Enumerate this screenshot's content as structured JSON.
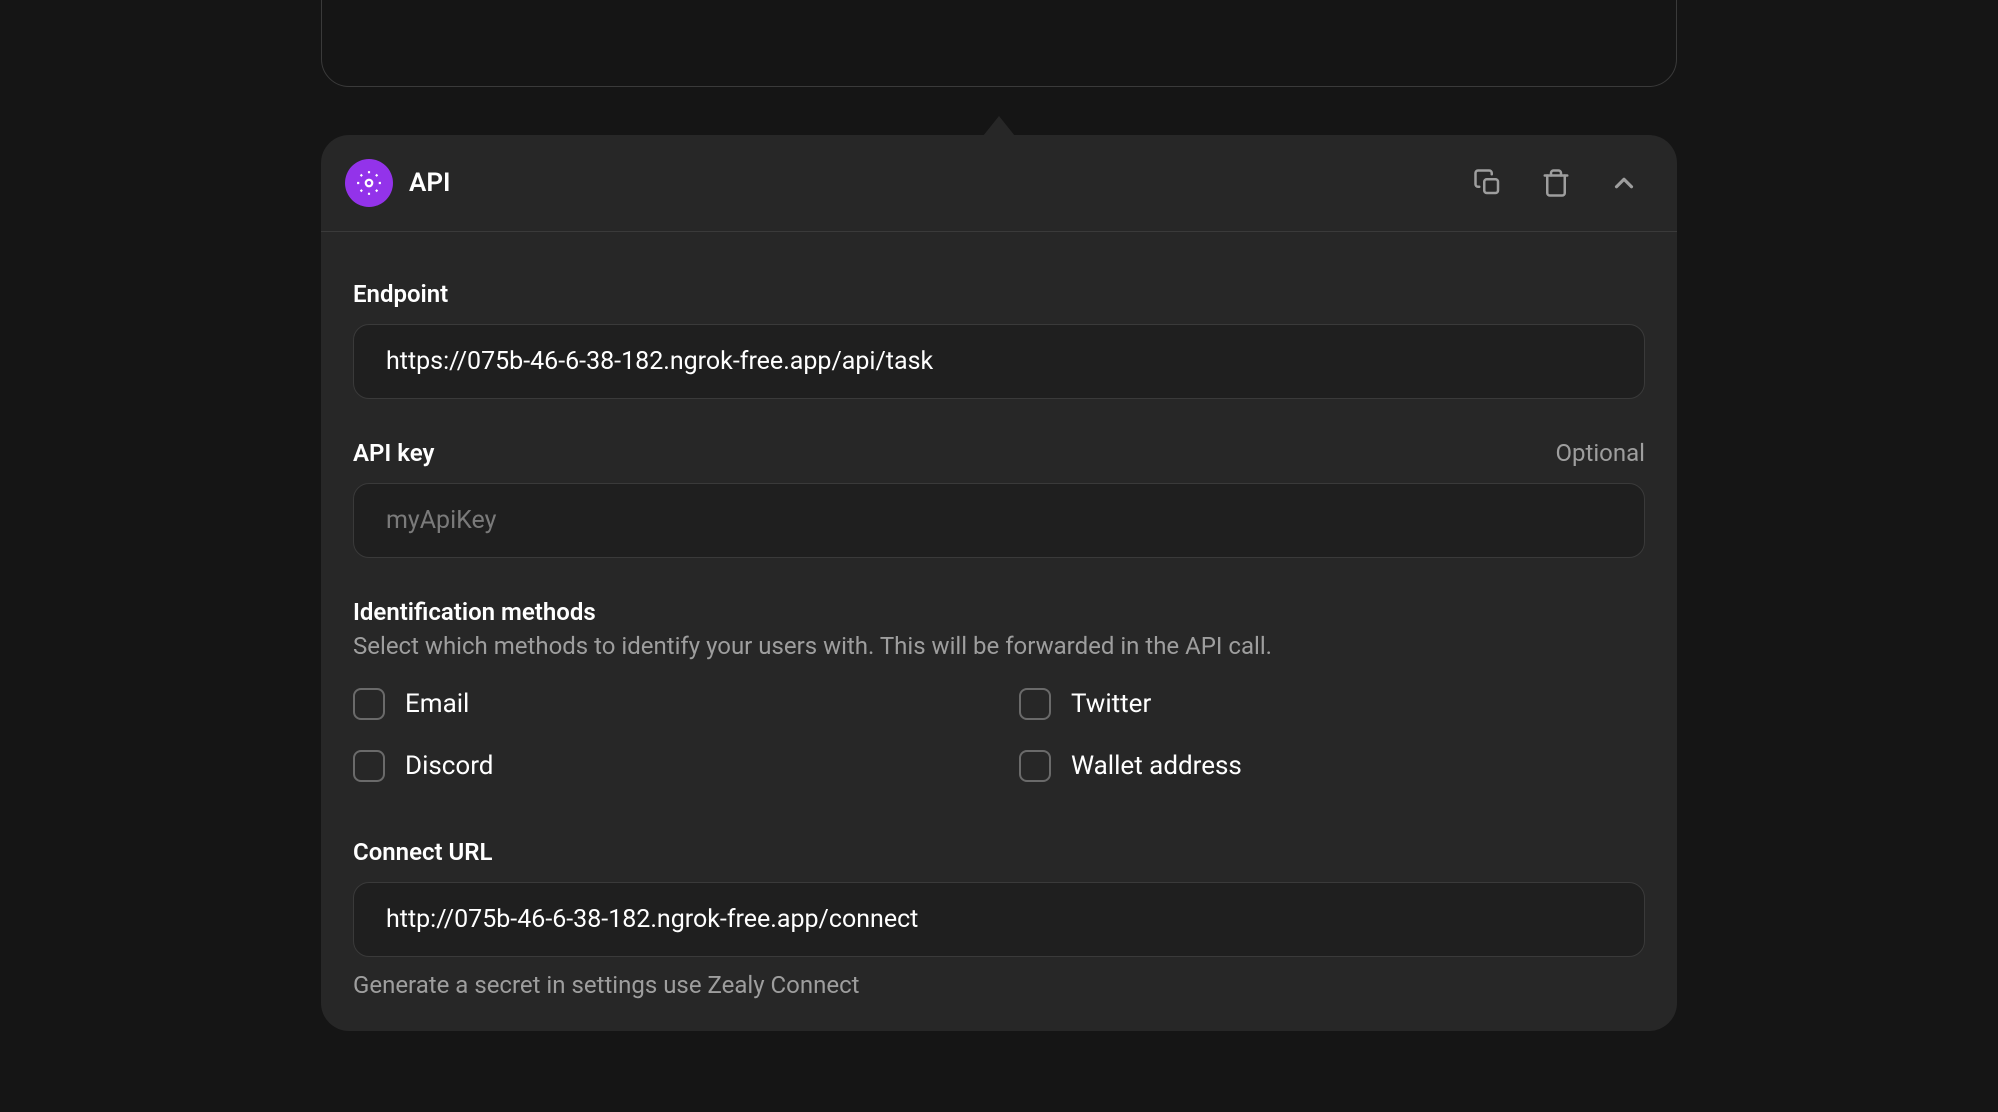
{
  "card": {
    "title": "API",
    "endpoint": {
      "label": "Endpoint",
      "value": "https://075b-46-6-38-182.ngrok-free.app/api/task"
    },
    "apiKey": {
      "label": "API key",
      "optional": "Optional",
      "placeholder": "myApiKey",
      "value": ""
    },
    "identification": {
      "title": "Identification methods",
      "subtitle": "Select which methods to identify your users with. This will be forwarded in the API call.",
      "options": {
        "email": "Email",
        "twitter": "Twitter",
        "discord": "Discord",
        "wallet": "Wallet address"
      }
    },
    "connectUrl": {
      "label": "Connect URL",
      "value": "http://075b-46-6-38-182.ngrok-free.app/connect",
      "help": "Generate a secret in settings use Zealy Connect"
    }
  }
}
